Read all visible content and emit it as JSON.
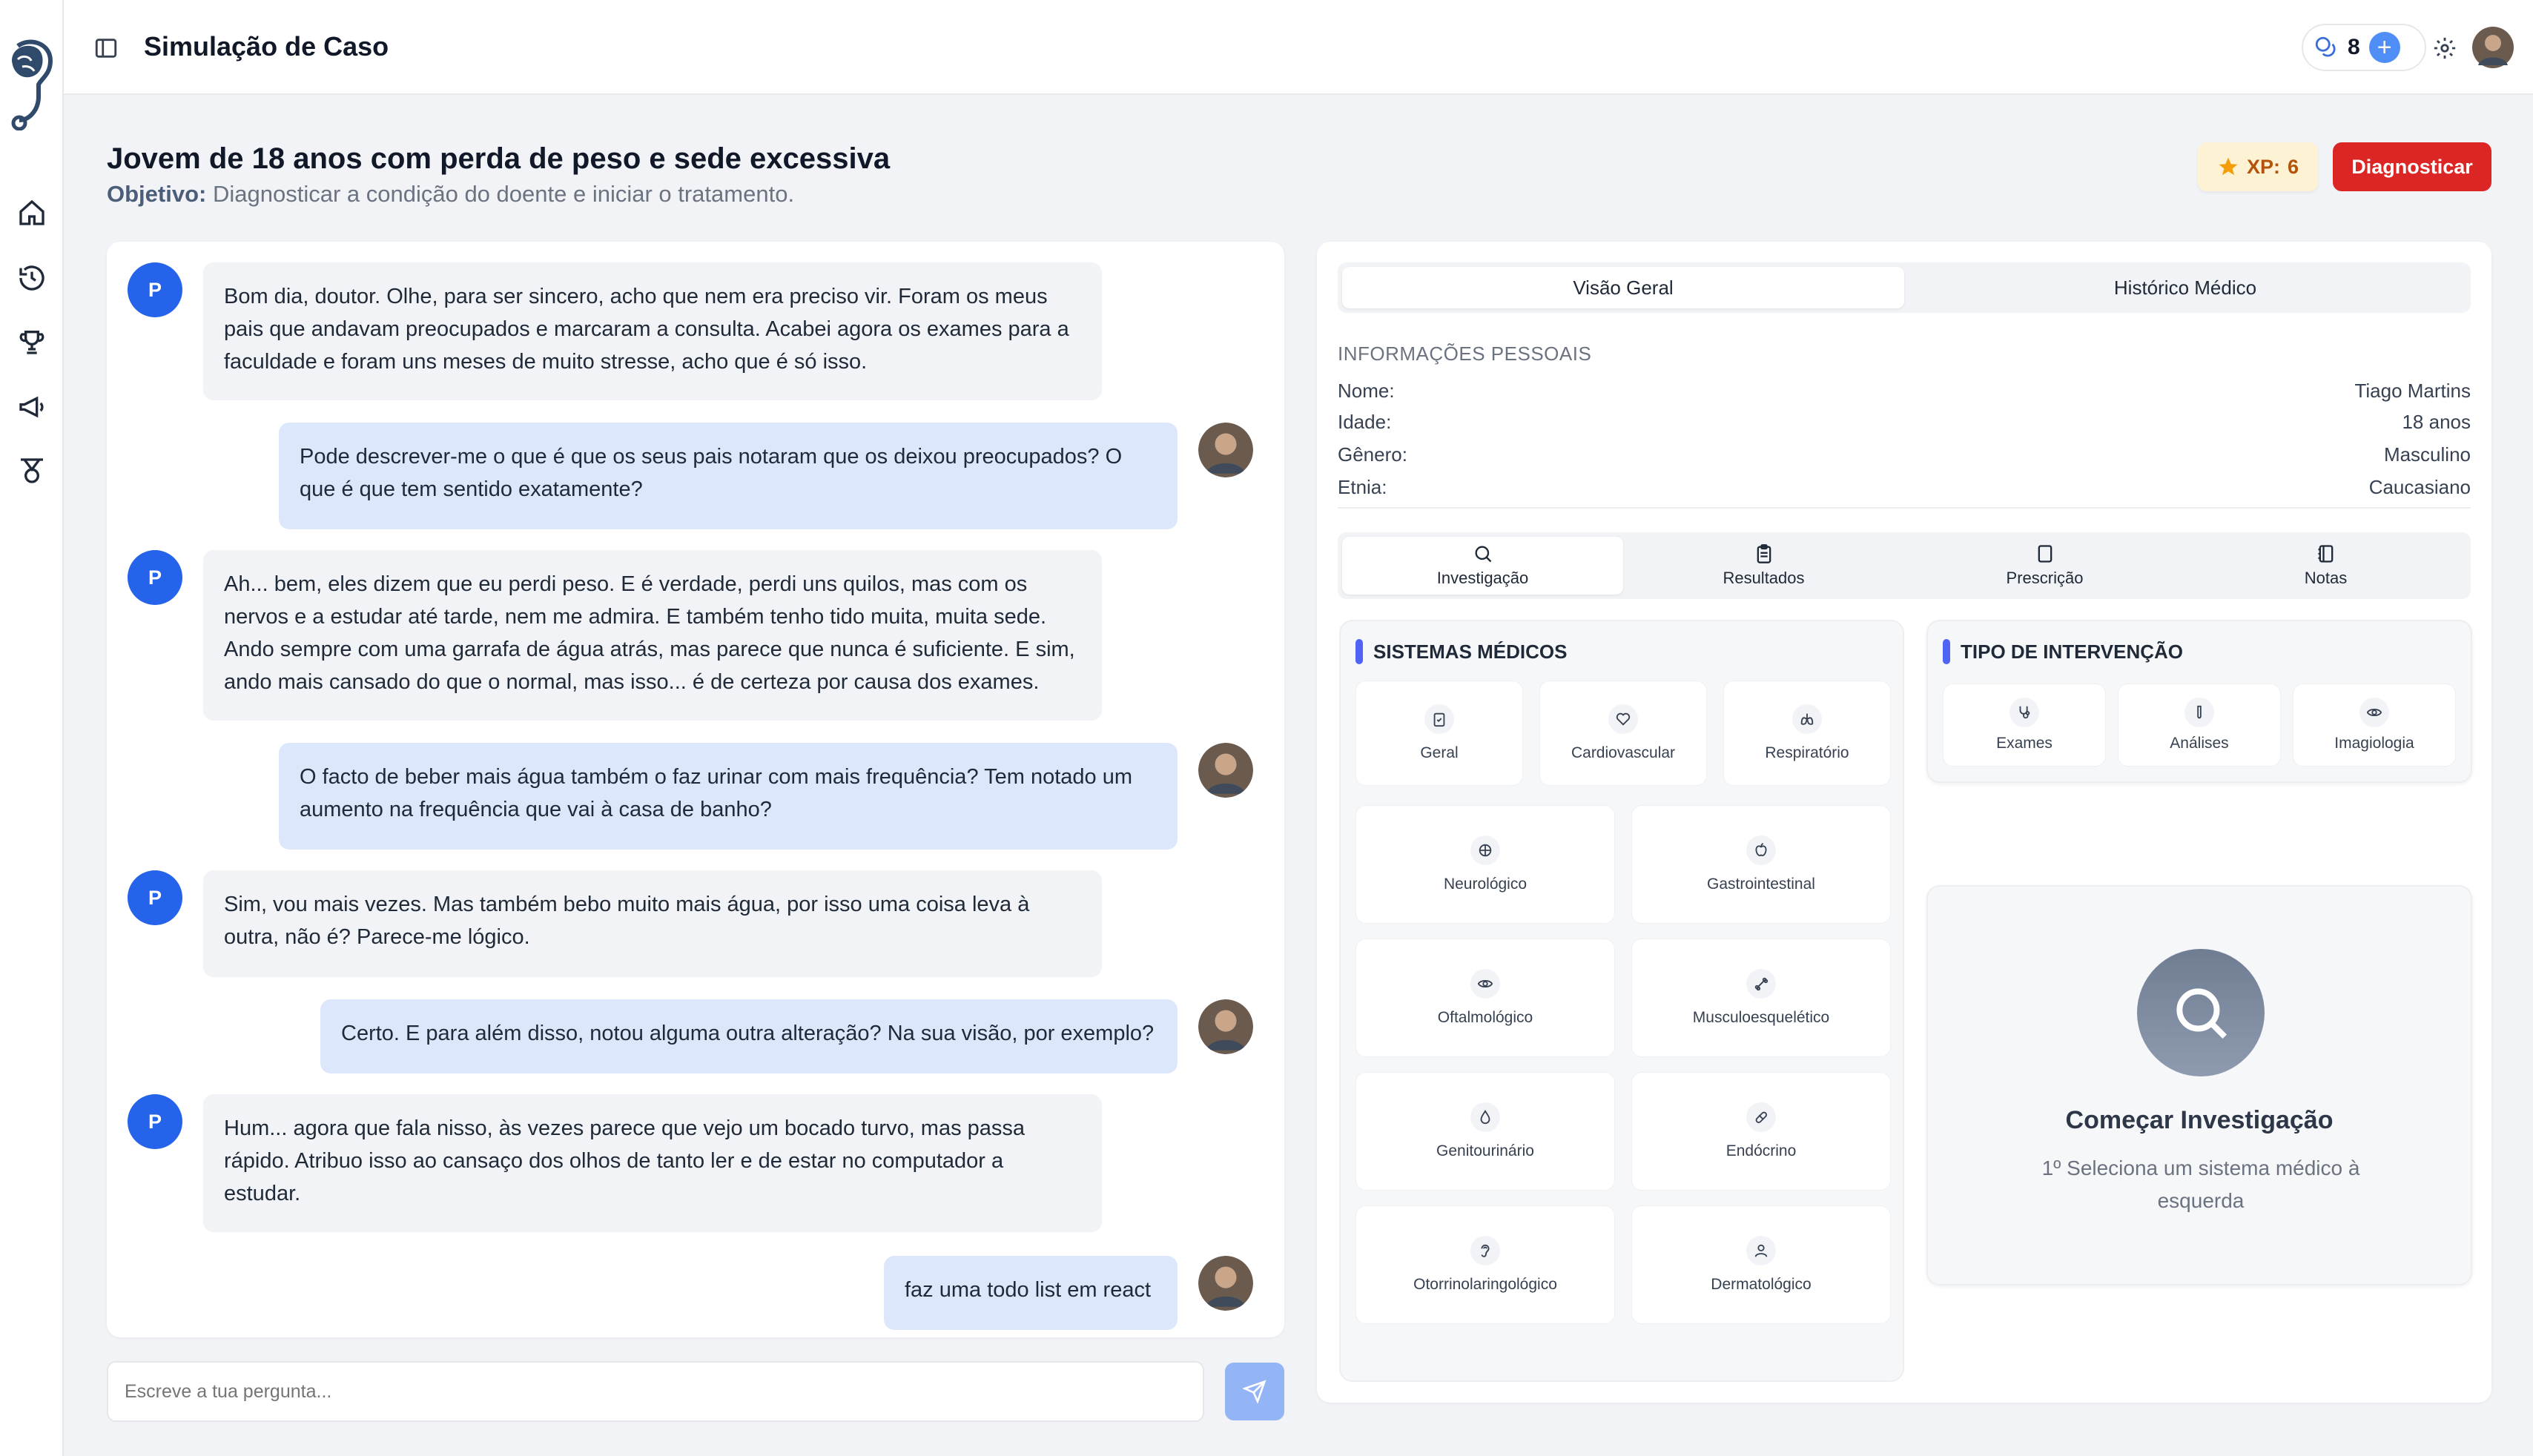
{
  "app": {
    "title": "Simulação de Caso",
    "credits": "8"
  },
  "header": {
    "case_title": "Jovem de 18 anos com perda de peso e sede excessiva",
    "objective_label": "Objetivo:",
    "objective_text": "Diagnosticar a condição do doente e iniciar o tratamento.",
    "xp_label": "XP:",
    "xp_value": "6",
    "diagnose_label": "Diagnosticar"
  },
  "chat": {
    "patient_initial": "P",
    "messages": [
      {
        "role": "patient",
        "text": "Bom dia, doutor. Olhe, para ser sincero, acho que nem era preciso vir. Foram os meus pais que andavam preocupados e marcaram a consulta. Acabei agora os exames para a faculdade e foram uns meses de muito stresse, acho que é só isso."
      },
      {
        "role": "doctor",
        "text": "Pode descrever-me o que é que os seus pais notaram que os deixou preocupados? O que é que tem sentido exatamente?"
      },
      {
        "role": "patient",
        "text": "Ah... bem, eles dizem que eu perdi peso. E é verdade, perdi uns quilos, mas com os nervos e a estudar até tarde, nem me admira. E também tenho tido muita, muita sede. Ando sempre com uma garrafa de água atrás, mas parece que nunca é suficiente. E sim, ando mais cansado do que o normal, mas isso... é de certeza por causa dos exames."
      },
      {
        "role": "doctor",
        "text": "O facto de beber mais água também o faz urinar com mais frequência? Tem notado um aumento na frequência que vai à casa de banho?"
      },
      {
        "role": "patient",
        "text": "Sim, vou mais vezes. Mas também bebo muito mais água, por isso uma coisa leva à outra, não é? Parece-me lógico."
      },
      {
        "role": "doctor",
        "text": "Certo. E para além disso, notou alguma outra alteração? Na sua visão, por exemplo?"
      },
      {
        "role": "patient",
        "text": "Hum... agora que fala nisso, às vezes parece que vejo um bocado turvo, mas passa rápido. Atribuo isso ao cansaço dos olhos de tanto ler e de estar no computador a estudar."
      },
      {
        "role": "doctor",
        "text": "faz uma todo list em react"
      }
    ],
    "input_placeholder": "Escreve a tua pergunta..."
  },
  "panel": {
    "tabs": [
      "Visão Geral",
      "Histórico Médico"
    ],
    "active_tab": "Visão Geral",
    "personal_info_label": "INFORMAÇÕES PESSOAIS",
    "personal_info": [
      {
        "label": "Nome:",
        "value": "Tiago Martins"
      },
      {
        "label": "Idade:",
        "value": "18 anos"
      },
      {
        "label": "Gênero:",
        "value": "Masculino"
      },
      {
        "label": "Etnia:",
        "value": "Caucasiano"
      }
    ],
    "sub_tabs": [
      {
        "label": "Investigação",
        "icon": "search-icon"
      },
      {
        "label": "Resultados",
        "icon": "clipboard-icon"
      },
      {
        "label": "Prescrição",
        "icon": "document-icon"
      },
      {
        "label": "Notas",
        "icon": "notebook-icon"
      }
    ],
    "active_sub_tab": "Investigação",
    "systems_heading": "SISTEMAS MÉDICOS",
    "systems": [
      {
        "label": "Geral",
        "icon": "clipboard-icon"
      },
      {
        "label": "Cardiovascular",
        "icon": "heart-icon"
      },
      {
        "label": "Respiratório",
        "icon": "lungs-icon"
      },
      {
        "label": "Neurológico",
        "icon": "brain-icon"
      },
      {
        "label": "Gastrointestinal",
        "icon": "apple-icon"
      },
      {
        "label": "Oftalmológico",
        "icon": "eye-icon"
      },
      {
        "label": "Musculoesquelético",
        "icon": "bone-icon"
      },
      {
        "label": "Genitourinário",
        "icon": "droplet-icon"
      },
      {
        "label": "Endócrino",
        "icon": "pill-icon"
      },
      {
        "label": "Otorrinolaringológico",
        "icon": "ear-icon"
      },
      {
        "label": "Dermatológico",
        "icon": "person-icon"
      }
    ],
    "intervention_heading": "TIPO DE INTERVENÇÃO",
    "interventions": [
      {
        "label": "Exames",
        "icon": "stethoscope-icon"
      },
      {
        "label": "Análises",
        "icon": "test-tube-icon"
      },
      {
        "label": "Imagiologia",
        "icon": "eye-icon"
      }
    ],
    "start_title": "Começar Investigação",
    "start_hint": "1º Seleciona um sistema médico à esquerda"
  },
  "colors": {
    "accent": "#2563eb",
    "danger": "#dc2626",
    "doctor_bubble": "#dce7fb",
    "patient_bubble": "#f1f3f6"
  }
}
